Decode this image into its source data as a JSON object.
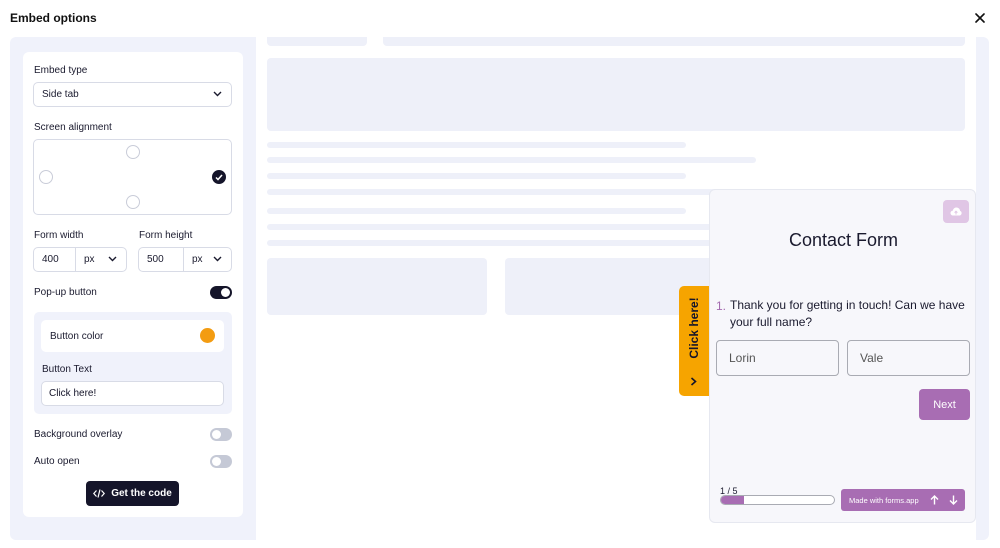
{
  "header": {
    "title": "Embed options"
  },
  "settings": {
    "embed_type": {
      "label": "Embed type",
      "value": "Side tab"
    },
    "screen_alignment": {
      "label": "Screen alignment",
      "selected": "right"
    },
    "form_width": {
      "label": "Form width",
      "value": "400",
      "unit": "px"
    },
    "form_height": {
      "label": "Form height",
      "value": "500",
      "unit": "px"
    },
    "popup_button": {
      "label": "Pop-up button",
      "enabled": true
    },
    "button_color": {
      "label": "Button color",
      "color": "#f39c12"
    },
    "button_text": {
      "label": "Button Text",
      "value": "Click here!"
    },
    "background_overlay": {
      "label": "Background overlay",
      "enabled": false
    },
    "auto_open": {
      "label": "Auto open",
      "enabled": false
    },
    "get_code": {
      "label": "Get the code"
    }
  },
  "preview": {
    "side_tab_label": "Click here!",
    "form": {
      "title": "Contact Form",
      "question_number": "1.",
      "question": "Thank you for getting in touch! Can we have your full name?",
      "first_name_value": "Lorin",
      "last_name_value": "Vale",
      "next_label": "Next",
      "progress_text": "1 / 5",
      "progress_fraction": 0.2,
      "made_with": "Made with forms.app"
    }
  },
  "colors": {
    "accent": "#a86db3",
    "tab": "#f6a400",
    "dark": "#15152a",
    "toggle_on": "#15152a",
    "toggle_off": "#c5c9d6"
  }
}
